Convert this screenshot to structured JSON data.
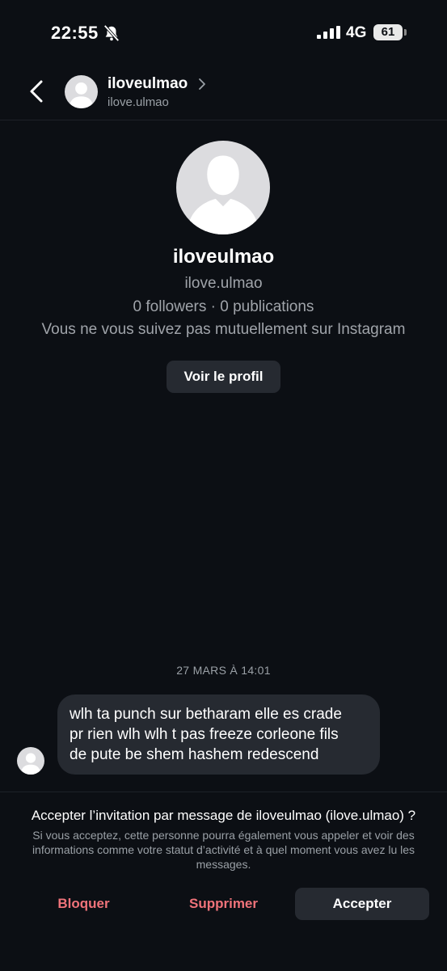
{
  "status_bar": {
    "time": "22:55",
    "network": "4G",
    "battery": "61",
    "icons": [
      "bell-slash-icon",
      "signal-icon",
      "battery-icon"
    ]
  },
  "header": {
    "name": "iloveulmao",
    "handle": "ilove.ulmao",
    "icons": [
      "back-arrow-icon",
      "chevron-right-icon",
      "avatar-icon"
    ]
  },
  "profile": {
    "name": "iloveulmao",
    "handle": "ilove.ulmao",
    "stats": "0 followers · 0 publications",
    "mutual": "Vous ne vous suivez pas mutuellement sur Instagram",
    "view_profile_label": "Voir le profil"
  },
  "conversation": {
    "timestamp": "27 MARS À 14:01",
    "message": {
      "line1": "wlh ta punch sur betharam elle es crade",
      "line2": "pr rien wlh wlh t pas freeze corleone fils",
      "line3": "de pute be shem hashem redescend"
    }
  },
  "request": {
    "title": "Accepter l’invitation par message de iloveulmao (ilove.ulmao) ?",
    "description": "Si vous acceptez, cette personne pourra également vous appeler et voir des informations comme votre statut d’activité et à quel moment vous avez lu les messages.",
    "block_label": "Bloquer",
    "delete_label": "Supprimer",
    "accept_label": "Accepter"
  },
  "colors": {
    "background": "#0c0f14",
    "bubble": "#262a31",
    "danger": "#f0737a",
    "secondary_text": "#9aa0a6"
  }
}
